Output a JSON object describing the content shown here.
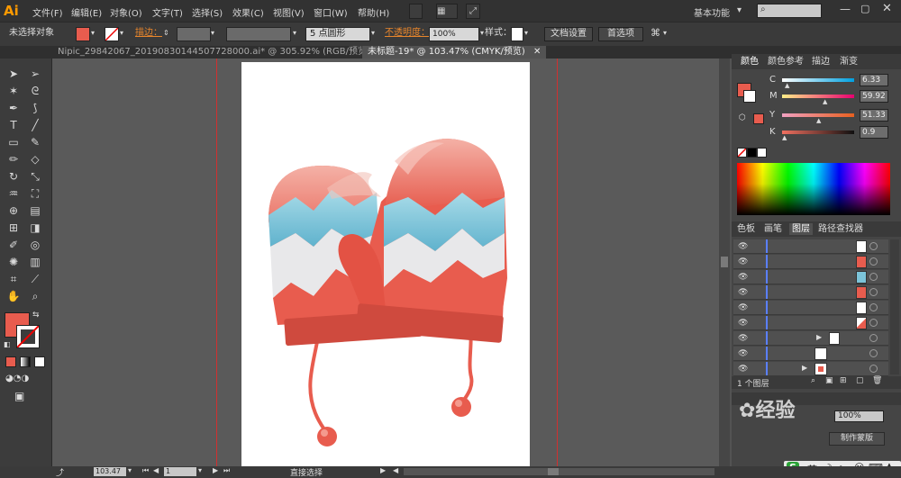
{
  "menubar": {
    "app_logo": "Ai",
    "items": [
      "文件(F)",
      "编辑(E)",
      "对象(O)",
      "文字(T)",
      "选择(S)",
      "效果(C)",
      "视图(V)",
      "窗口(W)",
      "帮助(H)"
    ],
    "workspace": "基本功能"
  },
  "control": {
    "selection_status": "未选择对象",
    "stroke_label": "描边：",
    "brush": "5 点圆形",
    "opacity_label": "不透明度：",
    "opacity_value": "100%",
    "style_label": "样式：",
    "doc_setup": "文档设置",
    "prefs": "首选项"
  },
  "tabs": [
    {
      "label": "Nipic_29842067_20190830144507728000.ai* @ 305.92% (RGB/预览)",
      "active": false
    },
    {
      "label": "未标题-19* @ 103.47% (CMYK/预览)",
      "active": true
    }
  ],
  "tools": [
    "selection-arrow",
    "direct-select",
    "magic-wand",
    "lasso",
    "pen",
    "curvature",
    "type",
    "line",
    "rectangle",
    "paintbrush",
    "pencil",
    "eraser",
    "rotate",
    "scale",
    "warp",
    "free-transform",
    "shape-builder",
    "perspective",
    "mesh",
    "gradient",
    "eyedropper",
    "blend",
    "symbol-sprayer",
    "graph",
    "artboard",
    "slice",
    "hand",
    "zoom"
  ],
  "colors": {
    "fill": "#e85c4e",
    "accent_red": "#e65a4c",
    "mitten_red": "#e85c4e",
    "mitten_dark": "#cf4a3e",
    "mitten_top": "#ed7b6b",
    "zigzag_blue": "#7cc4d9",
    "zigzag_white": "#e8e8ea",
    "orange_label": "#e8862c"
  },
  "color_panel": {
    "tabs": [
      "颜色",
      "颜色参考",
      "描边",
      "渐变"
    ],
    "channels": [
      {
        "label": "C",
        "value": "6.33",
        "pct": 0.06
      },
      {
        "label": "M",
        "value": "59.92",
        "pct": 0.6
      },
      {
        "label": "Y",
        "value": "51.33",
        "pct": 0.51
      },
      {
        "label": "K",
        "value": "0.9",
        "pct": 0.01
      }
    ]
  },
  "layers_panel": {
    "tabs": [
      "色板",
      "画笔",
      "图层",
      "路径查找器"
    ],
    "rows": 10,
    "count_label": "1 个图层"
  },
  "transparency": {
    "value": "100%",
    "make_mask": "制作蒙版"
  },
  "status": {
    "zoom": "103.47",
    "page": "1",
    "tool": "直接选择"
  },
  "watermark": {
    "logo_text": "经验",
    "ime": "英"
  }
}
